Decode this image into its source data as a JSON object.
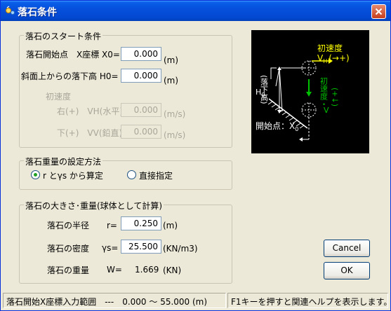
{
  "window": {
    "title": "落石条件"
  },
  "start": {
    "group_title": "落石のスタート条件",
    "x0_label": "落石開始点　X座標 X0=",
    "x0_value": "0.000",
    "x0_unit": "(m)",
    "h0_label": "斜面上からの落下高 H0=",
    "h0_value": "0.000",
    "h0_unit": "(m)",
    "v_label": "初速度",
    "vh_label": "右(+)　VH(水平)=",
    "vh_value": "0.000",
    "vh_unit": "(m/s)",
    "vv_label": "下(+)　VV(鉛直)=",
    "vv_value": "0.000",
    "vv_unit": "(m/s)"
  },
  "diagram": {
    "v_label": "初速度",
    "vh_sym": "V",
    "vh_sub": "H",
    "vh_dir": "(→+)",
    "vv_label": "初速度・",
    "vv_sym": "V",
    "vv_sub": "V",
    "vv_dir": "(+↓)",
    "h_label": "H",
    "h_sub": "0",
    "h_paren": "(落下高)",
    "start_label": "開始点：X",
    "start_sub": "0"
  },
  "weight": {
    "group_title": "落石重量の設定方法",
    "option_rgs": "r とγs から算定",
    "option_direct": "直接指定",
    "selected": "option_rgs"
  },
  "size": {
    "group_title": "落石の大きさ･重量(球体として計算)",
    "radius_label": "落石の半径",
    "radius_sym": "r=",
    "radius_value": "0.250",
    "radius_unit": "(m)",
    "density_label": "落石の密度",
    "density_sym": "γs=",
    "density_value": "25.500",
    "density_unit": "(KN/m3)",
    "weight_label": "落石の重量",
    "weight_sym": "W=",
    "weight_value": "1.669",
    "weight_unit": "(KN)"
  },
  "buttons": {
    "cancel": "Cancel",
    "ok": "OK"
  },
  "status": {
    "left": "落石開始X座標入力範囲　---　0.000 ～ 55.000 (m)",
    "right": "F1キーを押すと関連ヘルプを表示します。"
  },
  "colors": {
    "diagram_yellow": "#FFFF00",
    "diagram_green": "#00C000",
    "diagram_bg": "#000000"
  }
}
